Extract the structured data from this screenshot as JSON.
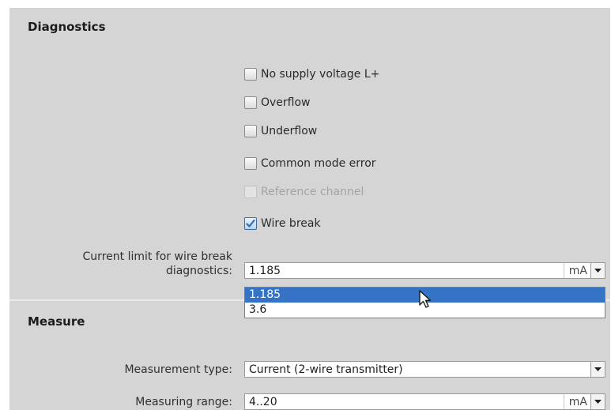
{
  "diagnostics": {
    "title": "Diagnostics",
    "checkboxes": [
      {
        "label": "No supply voltage L+",
        "checked": false,
        "enabled": true
      },
      {
        "label": "Overflow",
        "checked": false,
        "enabled": true
      },
      {
        "label": "Underflow",
        "checked": false,
        "enabled": true
      },
      {
        "label": "Common mode error",
        "checked": false,
        "enabled": true
      },
      {
        "label": "Reference channel",
        "checked": false,
        "enabled": false
      },
      {
        "label": "Wire break",
        "checked": true,
        "enabled": true
      }
    ],
    "current_limit": {
      "label_line1": "Current limit for wire break",
      "label_line2": "diagnostics:",
      "value": "1.185",
      "unit": "mA",
      "options": [
        "1.185",
        "3.6"
      ],
      "selected_option": "1.185"
    }
  },
  "measure": {
    "title": "Measure",
    "measurement_type": {
      "label": "Measurement type:",
      "value": "Current (2-wire transmitter)"
    },
    "measuring_range": {
      "label": "Measuring range:",
      "value": "4..20",
      "unit": "mA"
    }
  },
  "colors": {
    "panel_bg": "#d5d5d5",
    "selection": "#3573c6",
    "checkmark": "#2f6fb5"
  }
}
